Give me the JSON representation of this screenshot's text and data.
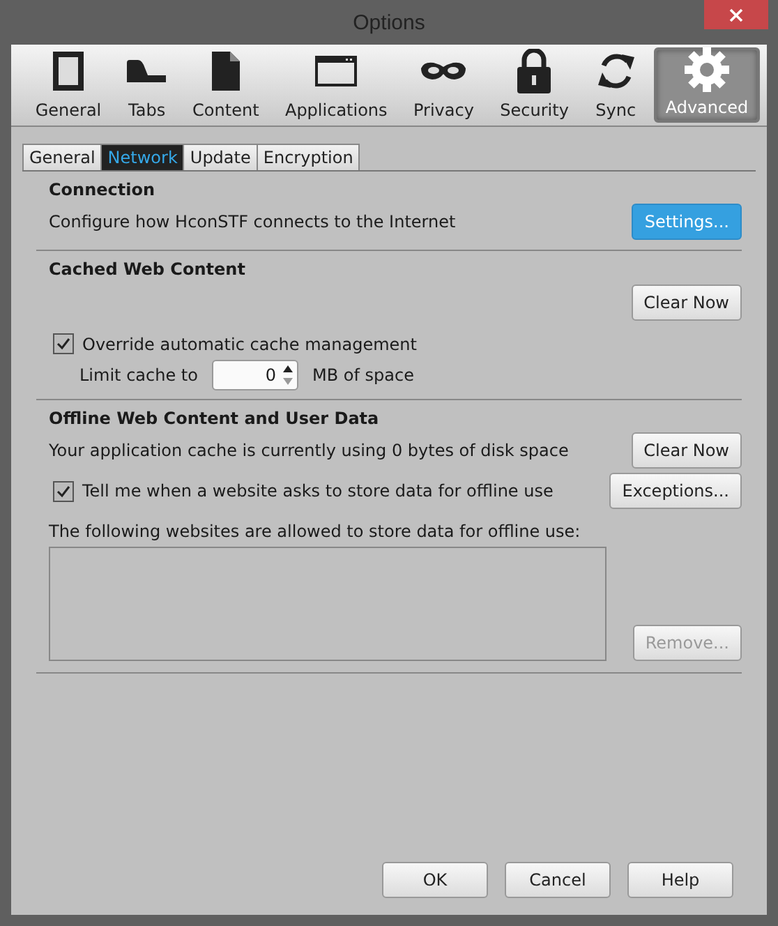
{
  "window": {
    "title": "Options"
  },
  "panes": [
    {
      "label": "General",
      "kind": "general",
      "selected": false
    },
    {
      "label": "Tabs",
      "kind": "tabs",
      "selected": false
    },
    {
      "label": "Content",
      "kind": "content",
      "selected": false
    },
    {
      "label": "Applications",
      "kind": "applications",
      "selected": false
    },
    {
      "label": "Privacy",
      "kind": "privacy",
      "selected": false
    },
    {
      "label": "Security",
      "kind": "security",
      "selected": false
    },
    {
      "label": "Sync",
      "kind": "sync",
      "selected": false
    },
    {
      "label": "Advanced",
      "kind": "advanced",
      "selected": true
    }
  ],
  "tabs": [
    {
      "label": "General",
      "selected": false
    },
    {
      "label": "Network",
      "selected": true
    },
    {
      "label": "Update",
      "selected": false
    },
    {
      "label": "Encryption",
      "selected": false
    }
  ],
  "connection": {
    "heading": "Connection",
    "description": "Configure how HconSTF connects to the Internet",
    "button": {
      "label": "Settings...",
      "focused": true
    }
  },
  "cache": {
    "heading": "Cached Web Content",
    "clear_button": "Clear Now",
    "override": {
      "label": "Override automatic cache management",
      "checked": true
    },
    "limit_label": "Limit cache to",
    "limit_value": "0",
    "limit_unit": "MB of space"
  },
  "offline": {
    "heading": "Offline Web Content and User Data",
    "usage": "Your application cache is currently using 0 bytes of disk space",
    "clear_button": "Clear Now",
    "notify": {
      "label": "Tell me when a website asks to store data for offline use",
      "checked": true
    },
    "exceptions_button": "Exceptions...",
    "list_label": "The following websites are allowed to store data for offline use:",
    "remove_button": {
      "label": "Remove...",
      "disabled": true
    }
  },
  "buttons": [
    "OK",
    "Cancel",
    "Help"
  ]
}
